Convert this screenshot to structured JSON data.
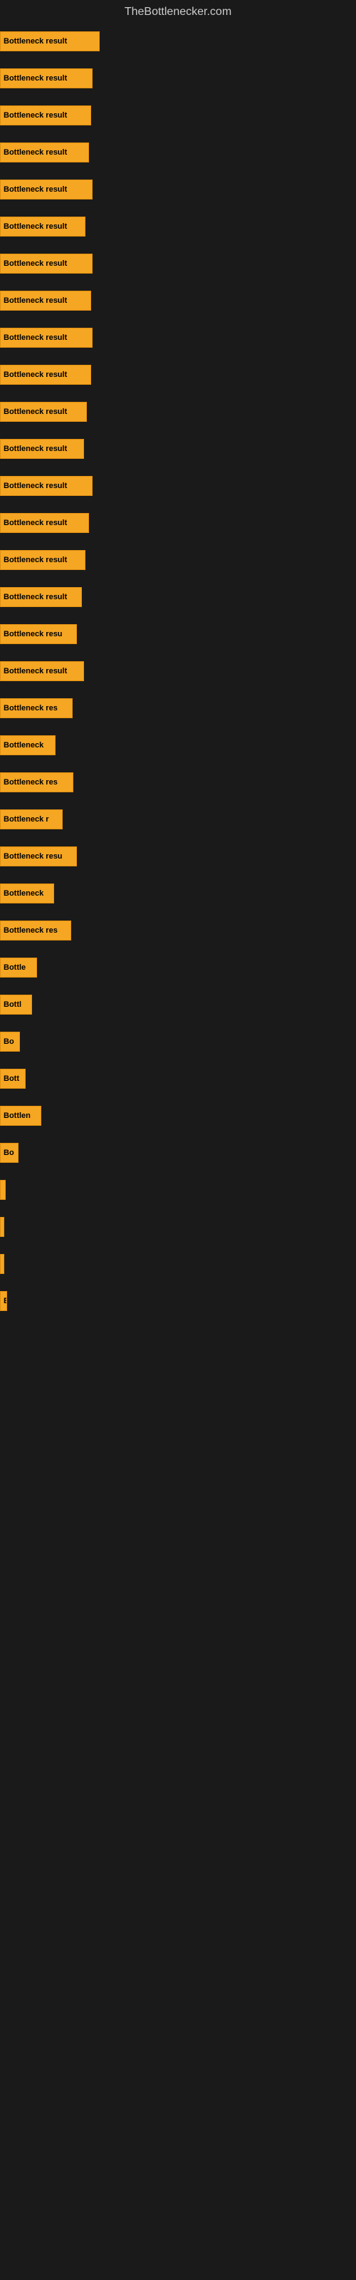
{
  "site": {
    "title": "TheBottlenecker.com"
  },
  "bars": [
    {
      "id": 1,
      "label": "Bottleneck result",
      "width": 140,
      "gap_after": true
    },
    {
      "id": 2,
      "label": "Bottleneck result",
      "width": 130,
      "gap_after": true
    },
    {
      "id": 3,
      "label": "Bottleneck result",
      "width": 128,
      "gap_after": true
    },
    {
      "id": 4,
      "label": "Bottleneck result",
      "width": 125,
      "gap_after": true
    },
    {
      "id": 5,
      "label": "Bottleneck result",
      "width": 130,
      "gap_after": true
    },
    {
      "id": 6,
      "label": "Bottleneck result",
      "width": 120,
      "gap_after": true
    },
    {
      "id": 7,
      "label": "Bottleneck result",
      "width": 130,
      "gap_after": true
    },
    {
      "id": 8,
      "label": "Bottleneck result",
      "width": 128,
      "gap_after": true
    },
    {
      "id": 9,
      "label": "Bottleneck result",
      "width": 130,
      "gap_after": true
    },
    {
      "id": 10,
      "label": "Bottleneck result",
      "width": 128,
      "gap_after": true
    },
    {
      "id": 11,
      "label": "Bottleneck result",
      "width": 122,
      "gap_after": true
    },
    {
      "id": 12,
      "label": "Bottleneck result",
      "width": 118,
      "gap_after": true
    },
    {
      "id": 13,
      "label": "Bottleneck result",
      "width": 130,
      "gap_after": true
    },
    {
      "id": 14,
      "label": "Bottleneck result",
      "width": 125,
      "gap_after": true
    },
    {
      "id": 15,
      "label": "Bottleneck result",
      "width": 120,
      "gap_after": true
    },
    {
      "id": 16,
      "label": "Bottleneck result",
      "width": 115,
      "gap_after": true
    },
    {
      "id": 17,
      "label": "Bottleneck resu",
      "width": 108,
      "gap_after": true
    },
    {
      "id": 18,
      "label": "Bottleneck result",
      "width": 118,
      "gap_after": true
    },
    {
      "id": 19,
      "label": "Bottleneck res",
      "width": 102,
      "gap_after": true
    },
    {
      "id": 20,
      "label": "Bottleneck",
      "width": 78,
      "gap_after": true
    },
    {
      "id": 21,
      "label": "Bottleneck res",
      "width": 103,
      "gap_after": true
    },
    {
      "id": 22,
      "label": "Bottleneck r",
      "width": 88,
      "gap_after": true
    },
    {
      "id": 23,
      "label": "Bottleneck resu",
      "width": 108,
      "gap_after": true
    },
    {
      "id": 24,
      "label": "Bottleneck",
      "width": 76,
      "gap_after": true
    },
    {
      "id": 25,
      "label": "Bottleneck res",
      "width": 100,
      "gap_after": true
    },
    {
      "id": 26,
      "label": "Bottle",
      "width": 52,
      "gap_after": true
    },
    {
      "id": 27,
      "label": "Bottl",
      "width": 45,
      "gap_after": true
    },
    {
      "id": 28,
      "label": "Bo",
      "width": 28,
      "gap_after": true
    },
    {
      "id": 29,
      "label": "Bott",
      "width": 36,
      "gap_after": true
    },
    {
      "id": 30,
      "label": "Bottlen",
      "width": 58,
      "gap_after": true
    },
    {
      "id": 31,
      "label": "Bo",
      "width": 26,
      "gap_after": true
    },
    {
      "id": 32,
      "label": "",
      "width": 8,
      "gap_after": true
    },
    {
      "id": 33,
      "label": "|",
      "width": 6,
      "gap_after": true
    },
    {
      "id": 34,
      "label": "",
      "width": 4,
      "gap_after": true
    },
    {
      "id": 35,
      "label": "E",
      "width": 10,
      "gap_after": false
    },
    {
      "id": 36,
      "label": "",
      "width": 0,
      "gap_after": false
    },
    {
      "id": 37,
      "label": "",
      "width": 0,
      "gap_after": false
    },
    {
      "id": 38,
      "label": "",
      "width": 0,
      "gap_after": false
    }
  ]
}
